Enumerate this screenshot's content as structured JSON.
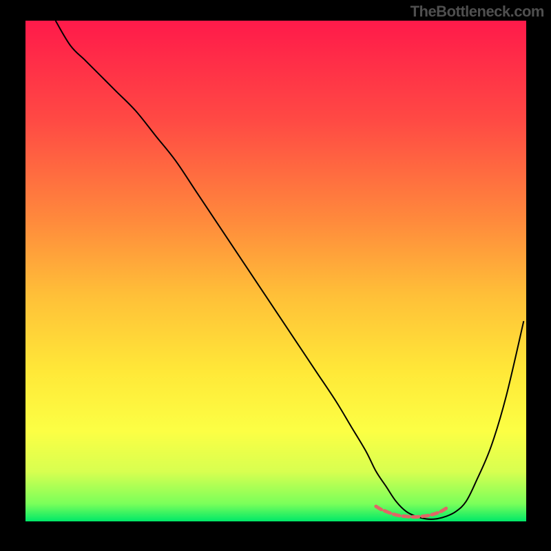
{
  "watermark": "TheBottleneck.com",
  "chart_data": {
    "type": "line",
    "title": "",
    "xlabel": "",
    "ylabel": "",
    "xlim": [
      0,
      100
    ],
    "ylim": [
      0,
      100
    ],
    "gradient_stops": [
      {
        "pos": 0,
        "color": "#ff1a4a"
      },
      {
        "pos": 0.2,
        "color": "#ff4a44"
      },
      {
        "pos": 0.4,
        "color": "#ff8a3c"
      },
      {
        "pos": 0.55,
        "color": "#ffc038"
      },
      {
        "pos": 0.7,
        "color": "#ffe838"
      },
      {
        "pos": 0.82,
        "color": "#fcff44"
      },
      {
        "pos": 0.9,
        "color": "#d8ff50"
      },
      {
        "pos": 0.965,
        "color": "#7aff5a"
      },
      {
        "pos": 1.0,
        "color": "#00e868"
      }
    ],
    "series": [
      {
        "name": "bottleneck-curve",
        "color": "#000000",
        "x": [
          6,
          9,
          12,
          15,
          18,
          22,
          26,
          30,
          34,
          38,
          42,
          46,
          50,
          54,
          58,
          62,
          65,
          68,
          70,
          72,
          74,
          76,
          78,
          80,
          82,
          84,
          86,
          88,
          90,
          93,
          96,
          99.5
        ],
        "values": [
          100,
          95,
          92,
          89,
          86,
          82,
          77,
          72,
          66,
          60,
          54,
          48,
          42,
          36,
          30,
          24,
          19,
          14,
          10,
          7,
          4,
          2,
          1,
          0.5,
          0.5,
          1,
          2,
          4,
          8,
          15,
          25,
          40
        ]
      },
      {
        "name": "optimal-range-marker",
        "color": "#e06666",
        "x": [
          70,
          71,
          72,
          73,
          74,
          75,
          76,
          77,
          78,
          79,
          80,
          81,
          82,
          83,
          84
        ],
        "values": [
          3.0,
          2.4,
          2.0,
          1.6,
          1.3,
          1.1,
          1.0,
          0.9,
          0.9,
          1.0,
          1.1,
          1.3,
          1.6,
          2.0,
          2.6
        ]
      }
    ]
  }
}
